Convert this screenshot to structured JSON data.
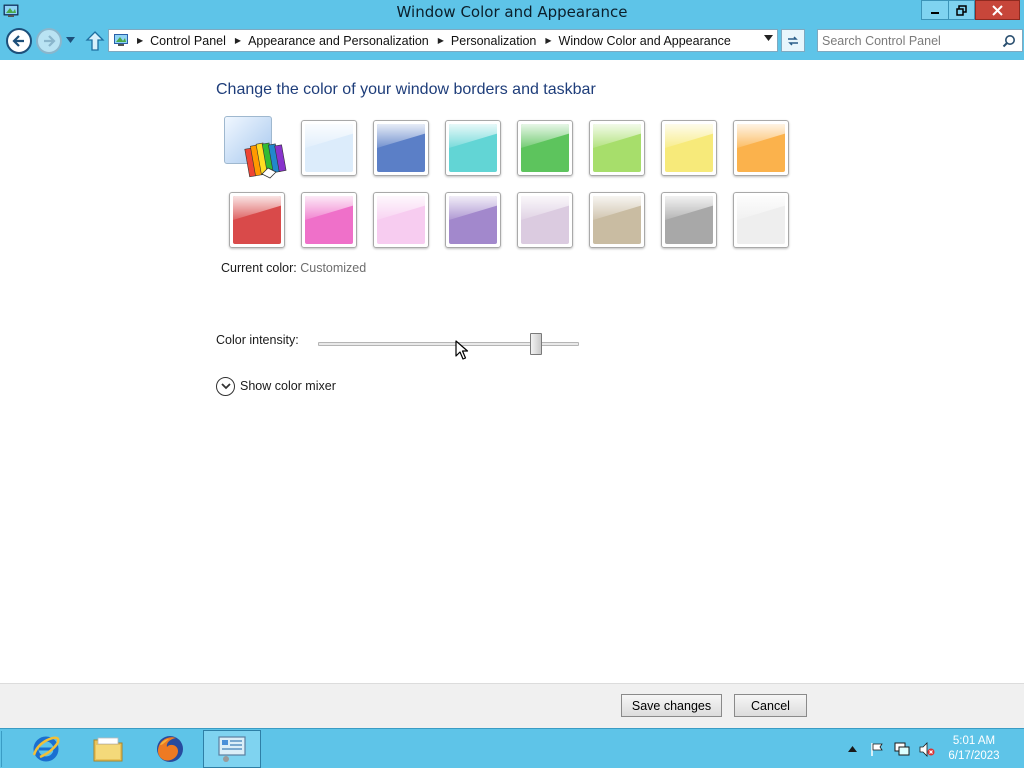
{
  "window": {
    "title": "Window Color and Appearance",
    "controls": {
      "minimize": "minimize",
      "restore": "restore",
      "close": "close"
    }
  },
  "nav": {
    "breadcrumbs": [
      "Control Panel",
      "Appearance and Personalization",
      "Personalization",
      "Window Color and Appearance"
    ],
    "search_placeholder": "Search Control Panel"
  },
  "main": {
    "heading": "Change the color of your window borders and taskbar",
    "swatches_row1": [
      {
        "name": "custom",
        "color": "#a7c8ee",
        "custom": true
      },
      {
        "name": "sky",
        "color": "#dcecfb"
      },
      {
        "name": "twilight",
        "color": "#5b7fc7"
      },
      {
        "name": "sea",
        "color": "#62d5d5"
      },
      {
        "name": "leaf",
        "color": "#5dc45d"
      },
      {
        "name": "lime",
        "color": "#a7de6b"
      },
      {
        "name": "lemon",
        "color": "#f7ea7a"
      },
      {
        "name": "pumpkin",
        "color": "#fbb24c"
      }
    ],
    "swatches_row2": [
      {
        "name": "ruby",
        "color": "#d94a4a"
      },
      {
        "name": "fuchsia",
        "color": "#ef70c9"
      },
      {
        "name": "blush",
        "color": "#f7ccf0"
      },
      {
        "name": "violet",
        "color": "#a288cc"
      },
      {
        "name": "lavender",
        "color": "#dbcbe0"
      },
      {
        "name": "taupe",
        "color": "#c9bca2"
      },
      {
        "name": "chocolate",
        "color": "#a8a8a8"
      },
      {
        "name": "frost",
        "color": "#eeeeee"
      }
    ],
    "current_color_label": "Current color:",
    "current_color_value": "Customized",
    "intensity_label": "Color intensity:",
    "intensity_value": 0.85,
    "mixer_label": "Show color mixer"
  },
  "footer": {
    "save_label": "Save changes",
    "cancel_label": "Cancel"
  },
  "taskbar": {
    "apps": [
      {
        "name": "internet-explorer-icon",
        "active": false
      },
      {
        "name": "file-explorer-icon",
        "active": false
      },
      {
        "name": "firefox-icon",
        "active": false
      },
      {
        "name": "control-panel-icon",
        "active": true
      }
    ],
    "clock_time": "5:01 AM",
    "clock_date": "6/17/2023"
  },
  "colors": {
    "chrome": "#5ec4e8",
    "heading": "#1e3d7a",
    "close_button": "#c7463a"
  }
}
